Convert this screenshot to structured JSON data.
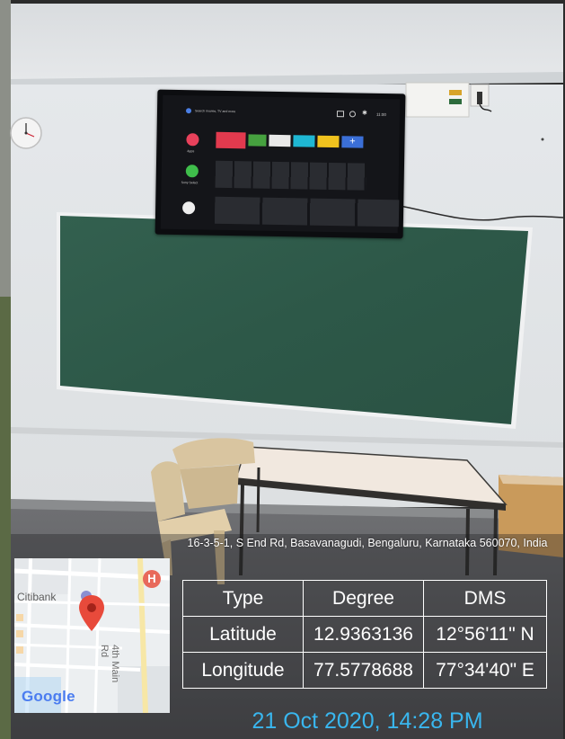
{
  "photo": {
    "scene": "classroom wall with a green chalkboard and wall-mounted TV",
    "colors": {
      "accent_timestamp": "#39b6ee",
      "chalkboard": "#2f5a4a",
      "wall": "#e7e9ec",
      "map_pin": "#e84a3b"
    }
  },
  "tv": {
    "search_hint": "Search movies, TV and more",
    "time": "11:00",
    "apps_label": "Apps",
    "store_label": "Sony Select"
  },
  "map": {
    "labels": {
      "bank": "Citibank",
      "road": "4th Main Rd",
      "brand": "Google"
    },
    "icons": [
      "location-pin-icon",
      "hospital-marker-icon"
    ]
  },
  "overlay": {
    "address": "16-3-5-1, S End Rd, Basavanagudi, Bengaluru, Karnataka 560070, India",
    "table": {
      "headers": [
        "Type",
        "Degree",
        "DMS"
      ],
      "rows": [
        {
          "type": "Latitude",
          "degree": "12.9363136",
          "dms": "12°56'11\" N"
        },
        {
          "type": "Longitude",
          "degree": "77.5778688",
          "dms": "77°34'40\" E"
        }
      ]
    },
    "timestamp": "21 Oct 2020, 14:28 PM"
  }
}
